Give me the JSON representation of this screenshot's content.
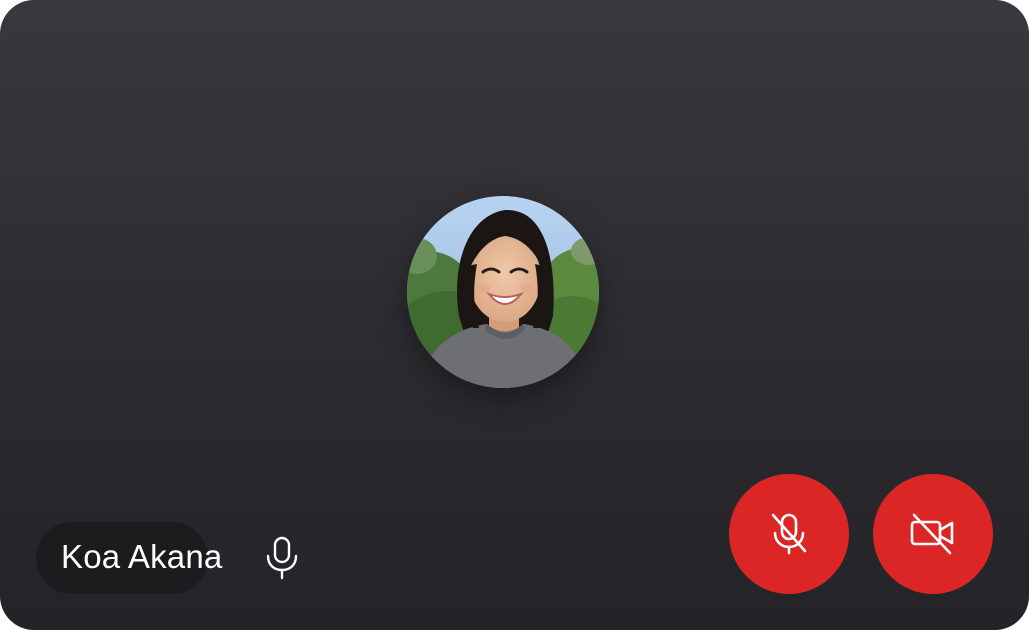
{
  "participant": {
    "name": "Koa Akana",
    "avatar_icon": "participant-photo",
    "mic_icon": "microphone-icon"
  },
  "controls": {
    "mute_icon": "microphone-off-icon",
    "camera_icon": "video-off-icon",
    "danger_color": "#dc2626"
  },
  "theme": {
    "tile_color": "#2e2e33",
    "pill_color": "#1c1c1f",
    "text_color": "#ffffff"
  }
}
